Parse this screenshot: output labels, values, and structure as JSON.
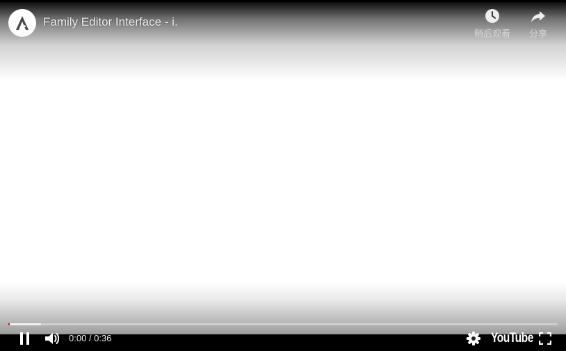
{
  "video": {
    "title": "Family Editor Interface - i.",
    "progress_fraction": 0.0,
    "buffered_fraction": 0.06
  },
  "top_actions": {
    "watch_later_label": "稍后观看",
    "share_label": "分享"
  },
  "controls": {
    "time_display": "0:00 / 0:36",
    "brand_label": "YouTube"
  },
  "colors": {
    "progress_played": "#ff0000",
    "controls_text": "#eeeeee"
  },
  "icons": {
    "avatar": "channel-avatar-a-logo",
    "watch_later": "clock-icon",
    "share": "share-arrow-icon",
    "pause": "pause-icon",
    "volume": "volume-icon",
    "settings": "gear-icon",
    "fullscreen": "fullscreen-icon"
  }
}
